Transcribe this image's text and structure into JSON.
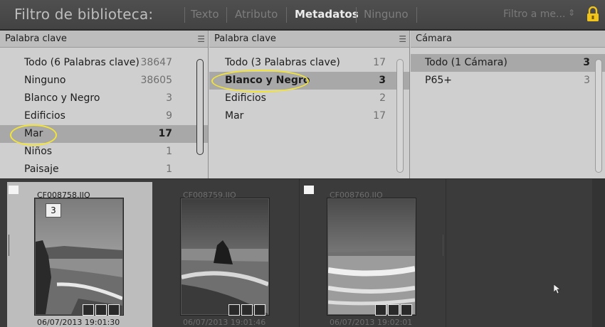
{
  "filter_bar": {
    "title": "Filtro de biblioteca:",
    "tabs": [
      "Texto",
      "Atributo",
      "Metadatos",
      "Ninguno"
    ],
    "active_tab": "Metadatos",
    "preset": "Filtro a me...",
    "preset_arrows": "⇕",
    "lock_color": "#f0c419"
  },
  "columns": [
    {
      "header": "Palabra clave",
      "rows": [
        {
          "label": "Todo (6 Palabras clave)",
          "count": "38647"
        },
        {
          "label": "Ninguno",
          "count": "38605"
        },
        {
          "label": "Blanco y Negro",
          "count": "3"
        },
        {
          "label": "Edificios",
          "count": "9"
        },
        {
          "label": "Mar",
          "count": "17",
          "selected": true,
          "circled": true
        },
        {
          "label": "Niños",
          "count": "1"
        },
        {
          "label": "Paisaje",
          "count": "1"
        }
      ]
    },
    {
      "header": "Palabra clave",
      "rows": [
        {
          "label": "Todo (3 Palabras clave)",
          "count": "17"
        },
        {
          "label": "Blanco y Negro",
          "count": "3",
          "selected": true,
          "circled": true
        },
        {
          "label": "Edificios",
          "count": "2"
        },
        {
          "label": "Mar",
          "count": "17"
        }
      ]
    },
    {
      "header": "Cámara",
      "rows": [
        {
          "label": "Todo (1 Cámara)",
          "count": "3",
          "selected": true
        },
        {
          "label": "P65+",
          "count": "3"
        }
      ]
    }
  ],
  "grid": {
    "cells": [
      {
        "filename": "CF008758.IIQ",
        "date": "06/07/2013 19:01:30",
        "stack_count": "3",
        "selected": true,
        "flagged": true
      },
      {
        "filename": "CF008759.IIQ",
        "date": "06/07/2013 19:01:46",
        "selected": false,
        "flagged": false
      },
      {
        "filename": "CF008760.IIQ",
        "date": "06/07/2013 19:02:01",
        "selected": false,
        "flagged": true
      }
    ]
  },
  "colors": {
    "highlight_ring": "#f2e33a",
    "panel_bg": "#cfcfcf",
    "selection_bg": "#a8a8a8"
  }
}
